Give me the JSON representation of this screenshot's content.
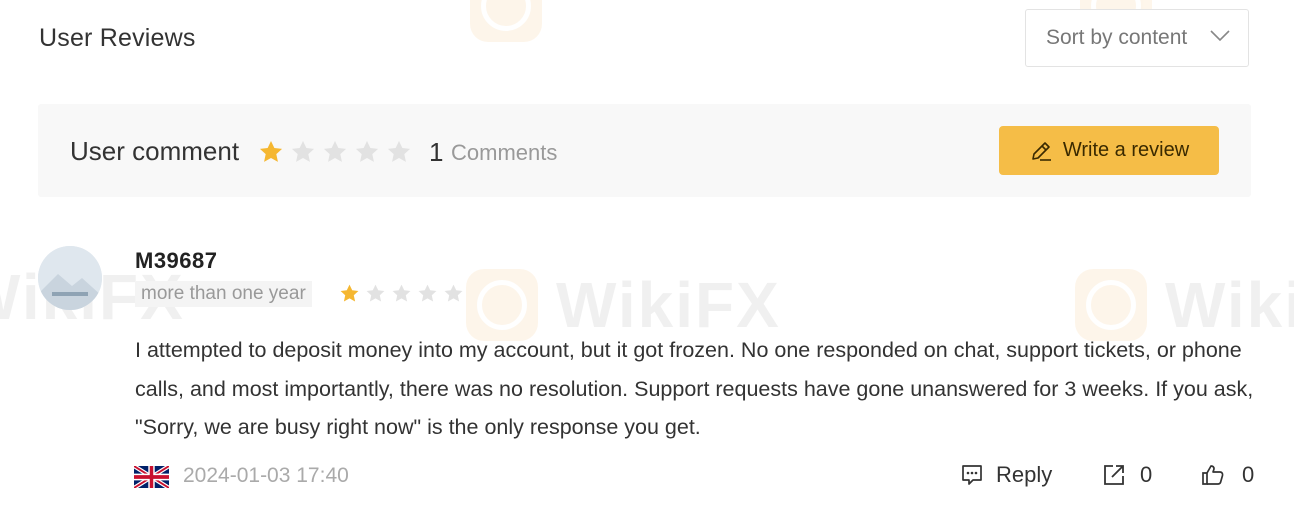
{
  "header": {
    "title": "User Reviews",
    "sort_label": "Sort by content"
  },
  "summary": {
    "label": "User comment",
    "rating": 1,
    "max_rating": 5,
    "count": "1",
    "count_label": "Comments",
    "write_label": "Write a review"
  },
  "review": {
    "username": "M39687",
    "time_ago": "more than one year",
    "rating": 1,
    "max_rating": 5,
    "text": "I attempted to deposit money into my account, but it got frozen. No one responded on chat, support tickets, or phone calls, and most importantly, there was no resolution. Support requests have gone unanswered for 3 weeks. If you ask, \"Sorry, we are busy right now\" is the only response you get.",
    "country_flag": "uk-flag-icon",
    "date": "2024-01-03 17:40",
    "reply_label": "Reply",
    "share_count": "0",
    "like_count": "0"
  },
  "watermark": "WikiFX",
  "colors": {
    "accent": "#f5bd47",
    "star_filled": "#f5b731",
    "star_empty": "#e2e2e2",
    "summary_bg": "#f8f8f8"
  }
}
